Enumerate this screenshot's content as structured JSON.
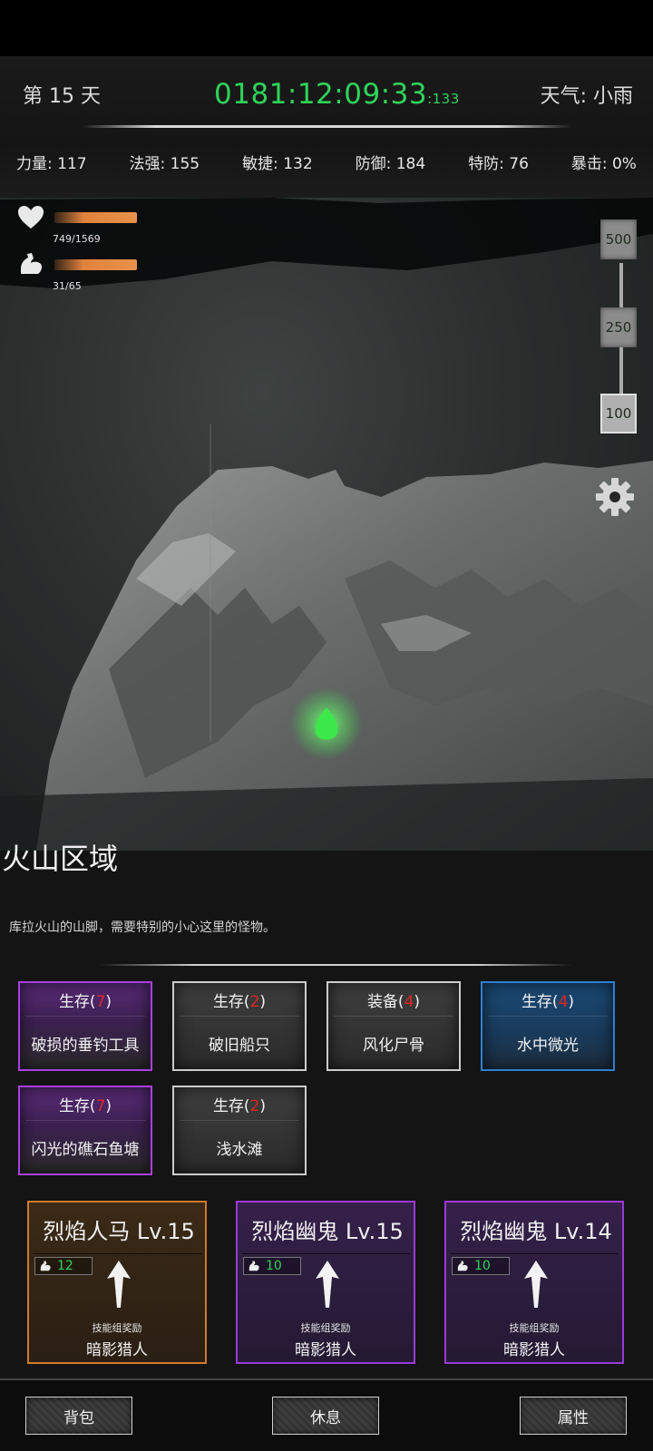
{
  "header": {
    "day": "第 15 天",
    "clock_main": "0181:12:09:33",
    "clock_ms": ":133",
    "weather": "天气: 小雨"
  },
  "stats": [
    {
      "label": "力量: 117"
    },
    {
      "label": "法强: 155"
    },
    {
      "label": "敏捷: 132"
    },
    {
      "label": "防御: 184"
    },
    {
      "label": "特防: 76"
    },
    {
      "label": "暴击: 0%"
    }
  ],
  "vitals": {
    "hp": {
      "text": "749/1569",
      "fraction": 0.477,
      "icon": "heart-icon"
    },
    "stamina": {
      "text": "31/65",
      "fraction": 0.477,
      "icon": "strength-arm-icon"
    }
  },
  "zoom_levels": [
    "500",
    "250",
    "100"
  ],
  "zoom_selected": "100",
  "area": {
    "title": "火山区域",
    "description": "库拉火山的山脚，需要特别的小心这里的怪物。"
  },
  "points_of_interest": [
    {
      "category": "生存(",
      "count": "7",
      "close": ")",
      "name": "破损的垂钓工具",
      "rarity": "purple"
    },
    {
      "category": "生存(",
      "count": "2",
      "close": ")",
      "name": "破旧船只",
      "rarity": "white"
    },
    {
      "category": "装备(",
      "count": "4",
      "close": ")",
      "name": "风化尸骨",
      "rarity": "white"
    },
    {
      "category": "生存(",
      "count": "4",
      "close": ")",
      "name": "水中微光",
      "rarity": "blue"
    },
    {
      "category": "生存(",
      "count": "7",
      "close": ")",
      "name": "闪光的礁石鱼塘",
      "rarity": "purple"
    },
    {
      "category": "生存(",
      "count": "2",
      "close": ")",
      "name": "浅水滩",
      "rarity": "white"
    }
  ],
  "enemies": [
    {
      "name": "烈焰人马 Lv.15",
      "energy": "12",
      "reward_label": "技能组奖励",
      "reward": "暗影猎人",
      "frame": "orange"
    },
    {
      "name": "烈焰幽鬼 Lv.15",
      "energy": "10",
      "reward_label": "技能组奖励",
      "reward": "暗影猎人",
      "frame": "violet"
    },
    {
      "name": "烈焰幽鬼 Lv.14",
      "energy": "10",
      "reward_label": "技能组奖励",
      "reward": "暗影猎人",
      "frame": "violet"
    }
  ],
  "bottom_nav": {
    "bag": "背包",
    "rest": "休息",
    "attributes": "属性"
  },
  "colors": {
    "clock": "#2fd35a",
    "count_red": "#e02525",
    "purple_frame": "#a740e0",
    "blue_frame": "#2f7fd0",
    "orange_frame": "#d17a2a",
    "bar_orange": "#e0823e",
    "player_marker": "#3ce84a"
  }
}
